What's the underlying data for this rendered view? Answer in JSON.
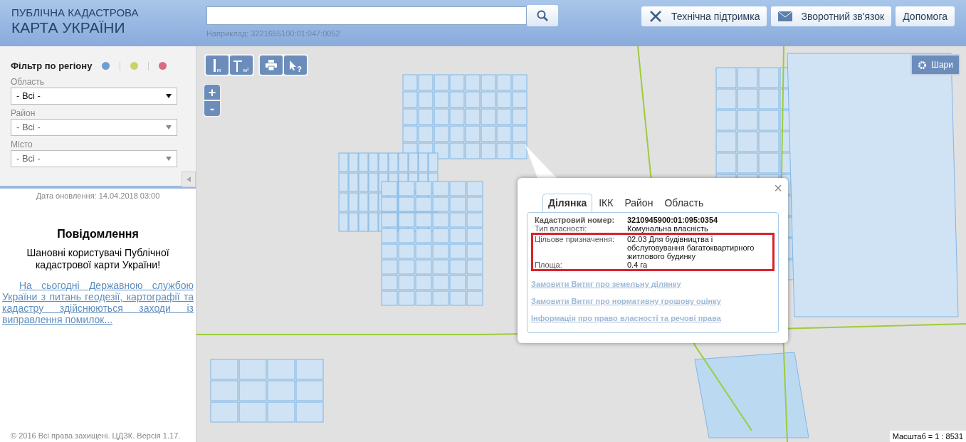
{
  "header": {
    "title_line_1": "ПУБЛІЧНА КАДАСТРОВА",
    "title_line_2": "КАРТА УКРАЇНИ",
    "search": {
      "hint": "Наприклад: 3221655100:01:047:0052"
    },
    "buttons": [
      {
        "kind": "support",
        "label": "Технічна підтримка"
      },
      {
        "kind": "feedback",
        "label": "Зворотний зв'язок"
      },
      {
        "kind": "help",
        "label": "Допомога"
      }
    ]
  },
  "sidebar": {
    "filter_title": "Фільтр по регіону",
    "filter_dots": [
      {
        "color": "#6a9fcf"
      },
      {
        "color": "#c9d36a"
      },
      {
        "color": "#d86a85"
      }
    ],
    "selects": [
      {
        "label": "Область",
        "value": "- Всі -",
        "disabled": false
      },
      {
        "label": "Район",
        "value": "- Всі -",
        "disabled": true
      },
      {
        "label": "Місто",
        "value": "- Всі -",
        "disabled": true
      }
    ],
    "update_date": "Дата оновлення: 14.04.2018 03:00",
    "notice": {
      "title": "Повідомлення",
      "greeting": "Шановні користувачі Публічної кадастрової карти України!",
      "link": "На сьогодні Державною службою України з питань геодезії, картографії та кадастру здійснюються заходи із виправлення помилок..."
    },
    "footer": "© 2016 Всі права захищені. ЦДЗК. Версія 1.17."
  },
  "map": {
    "tools": [
      {
        "kind": "ruler",
        "label": "м"
      },
      {
        "kind": "area",
        "label": "м²"
      },
      {
        "kind": "print"
      },
      {
        "kind": "identify",
        "label": "?"
      }
    ],
    "zoom_in": "+",
    "zoom_out": "-",
    "layers_button": "Шари",
    "scale": "Масштаб = 1 : 8531",
    "popup": {
      "close": "×",
      "tabs": [
        {
          "label": "Ділянка",
          "selected": true
        },
        {
          "label": "ІКК",
          "selected": false
        },
        {
          "label": "Район",
          "selected": false
        },
        {
          "label": "Область",
          "selected": false
        }
      ],
      "rows": [
        {
          "label": "Кадастровий номер:",
          "value": "3210945900:01:095:0354",
          "bold": true,
          "highlighted": false
        },
        {
          "label": "Тип власності:",
          "value": "Комунальна власність",
          "bold": false,
          "highlighted": false
        },
        {
          "label": "Цільове призначення:",
          "value": "02.03 Для будівництва і обслуговування багатоквартирного житлового будинку",
          "bold": false,
          "highlighted": true
        },
        {
          "label": "Площа:",
          "value": "0.4 га",
          "bold": false,
          "highlighted": true
        }
      ],
      "links": [
        "Замовити Витяг про земельну ділянку",
        "Замовити Витяг про нормативну грошову оцінку",
        "Інформація про право власності та речові права"
      ]
    }
  }
}
